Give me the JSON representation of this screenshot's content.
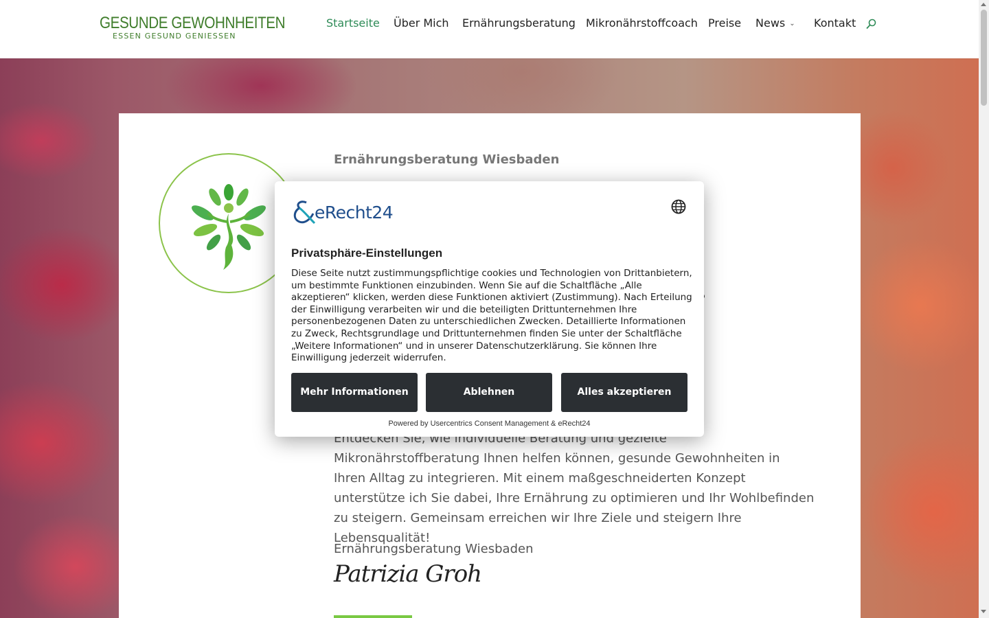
{
  "header": {
    "logo_main": "GESUNDE GEWOHNHEITEN",
    "logo_sub": "ESSEN GESUND GENIESSEN",
    "nav": [
      {
        "label": "Startseite",
        "active": true
      },
      {
        "label": "Über Mich",
        "active": false
      },
      {
        "label": "Ernährungsberatung",
        "active": false
      },
      {
        "label": "Mikronährstoffcoach",
        "active": false
      },
      {
        "label": "Preise",
        "active": false
      },
      {
        "label": "News",
        "active": false,
        "has_dropdown": true
      },
      {
        "label": "Kontakt",
        "active": false
      }
    ],
    "search_icon": "search-icon"
  },
  "hero": {
    "eyebrow": "Ernährungsberatung Wiesbaden",
    "body": "Entdecken Sie, wie individuelle Beratung und gezielte Mikronährstoffberatung Ihnen helfen können, gesunde Gewohnheiten in Ihren Alltag zu integrieren. Mit einem maßgeschneiderten Konzept unterstütze ich Sie dabei, Ihre Ernährung zu optimieren und Ihr Wohlbefinden zu steigern. Gemeinsam erreichen wir Ihre Ziele und steigern Ihre Lebensqualität!",
    "footer_line": "Ernährungsberatung Wiesbaden",
    "signature": "Patrizia Groh"
  },
  "consent": {
    "logo_text": "eRecht24",
    "title": "Privatsphäre-Einstellungen",
    "body": "Diese Seite nutzt zustimmungspflichtige cookies und Technologien von Drittanbietern, um bestimmte Funktionen einzubinden. Wenn Sie auf die Schaltfläche „Alle akzeptieren“ klicken, werden diese Funktionen aktiviert (Zustimmung). Nach Erteilung der Einwilligung verarbeiten wir und die beteiligten Drittunternehmen Ihre personenbezogenen Daten zu unterschiedlichen Zwecken. Detaillierte Informationen zu Zweck, Rechtsgrundlage und Drittunternehmen finden Sie unter der Schaltfläche „Weitere Informationen“ und in unserer Datenschutzerklärung. Sie können Ihre Einwilligung jederzeit widerrufen.",
    "buttons": {
      "more": "Mehr Informationen",
      "reject": "Ablehnen",
      "accept": "Alles akzeptieren"
    },
    "powered": "Powered by Usercentrics Consent Management & eRecht24"
  },
  "colors": {
    "nav_active": "#2e8b57",
    "brand_green": "#3f7d2b",
    "accent_green": "#7ac943",
    "button_dark": "#2b2f33",
    "erecht_blue": "#1f4e8c"
  }
}
